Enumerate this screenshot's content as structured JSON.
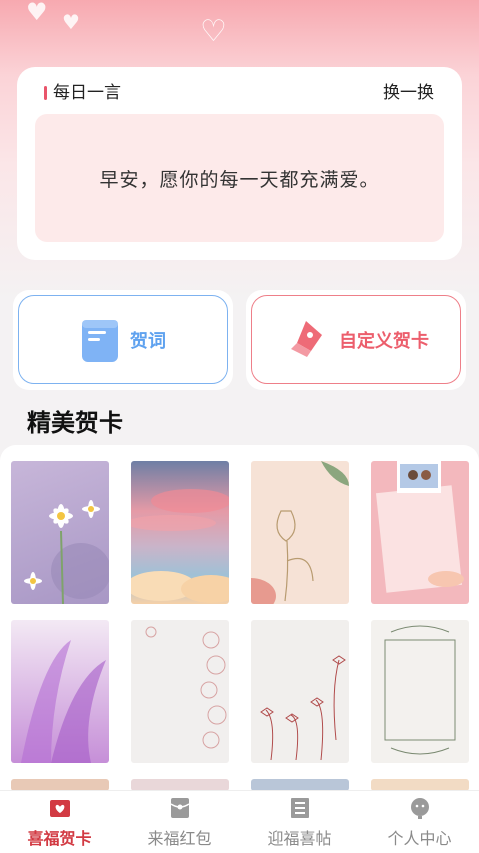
{
  "daily_quote": {
    "title": "每日一言",
    "refresh_label": "换一换",
    "text": "早安，愿你的每一天都充满爱。"
  },
  "actions": {
    "greeting_words": "贺词",
    "custom_card": "自定义贺卡"
  },
  "section": {
    "title": "精美贺卡"
  },
  "cards": [
    {
      "name": "daisy-purple"
    },
    {
      "name": "pink-sky-clouds"
    },
    {
      "name": "line-flower-beige"
    },
    {
      "name": "couple-photo-pink"
    },
    {
      "name": "purple-feather"
    },
    {
      "name": "lace-border"
    },
    {
      "name": "ribbon-bows"
    },
    {
      "name": "ornate-frame"
    }
  ],
  "tabs": [
    {
      "label": "喜福贺卡",
      "icon": "card-icon",
      "active": true
    },
    {
      "label": "来福红包",
      "icon": "envelope-icon",
      "active": false
    },
    {
      "label": "迎福喜帖",
      "icon": "invitation-icon",
      "active": false
    },
    {
      "label": "个人中心",
      "icon": "user-icon",
      "active": false
    }
  ],
  "colors": {
    "accent": "#d23a43",
    "blue": "#5fa2ef",
    "quote_bg": "#fdeaea"
  }
}
